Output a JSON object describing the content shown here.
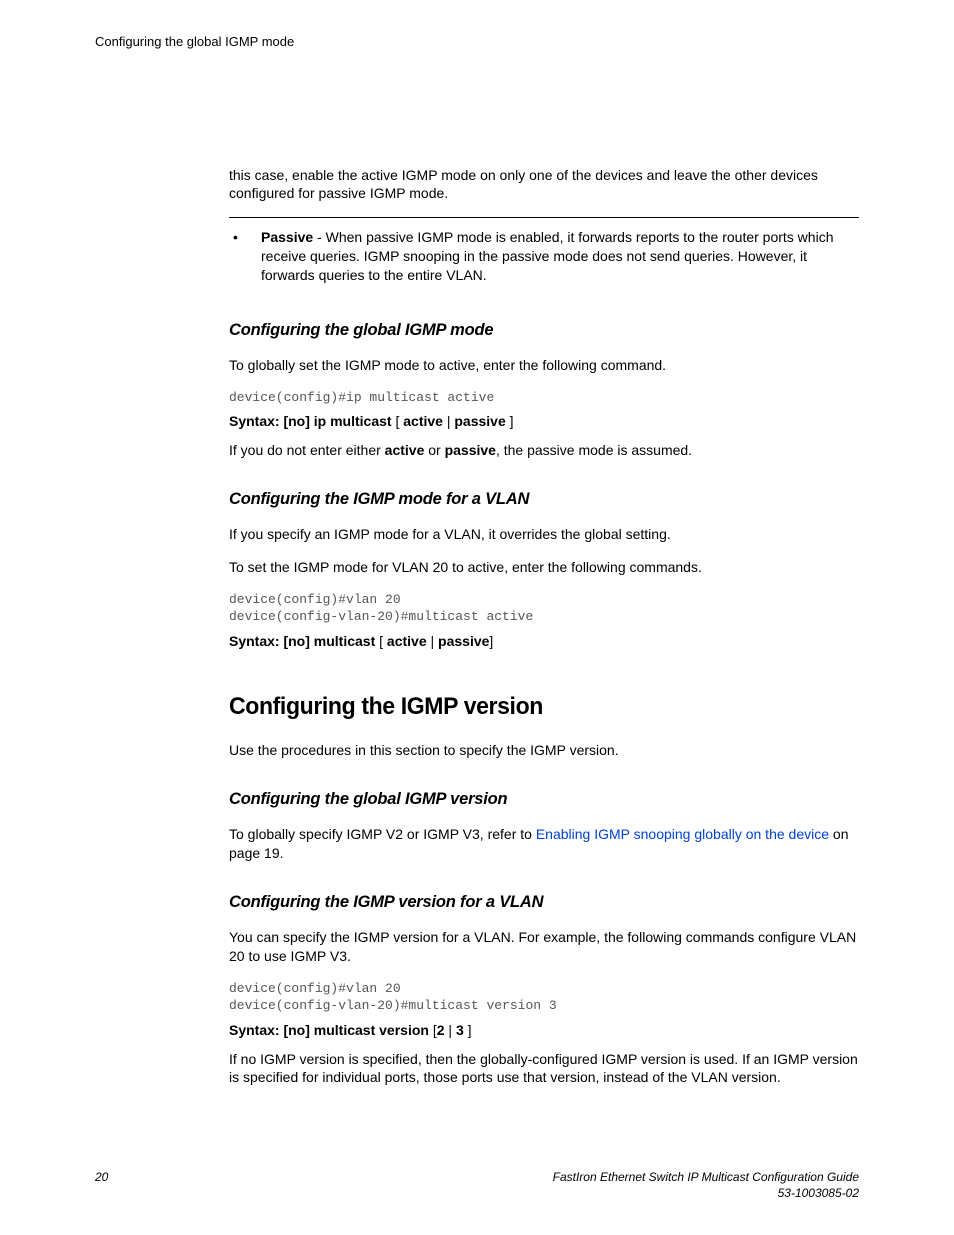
{
  "running_head": "Configuring the global IGMP mode",
  "intro_para": "this case, enable the active IGMP mode on only one of the devices and leave the other devices configured for passive IGMP mode.",
  "bullet": {
    "label": "Passive",
    "text": " - When passive IGMP mode is enabled, it forwards reports to the router ports which receive queries. IGMP snooping in the passive mode does not send queries. However, it forwards queries to the entire VLAN."
  },
  "sec_global_mode": {
    "heading": "Configuring the global IGMP mode",
    "p1": "To globally set the IGMP mode to active, enter the following command.",
    "code": "device(config)#ip multicast active",
    "syntax_prefix": "Syntax: [no] ip multicast",
    "syntax_open": " [ ",
    "syntax_opt1": "active",
    "syntax_pipe": " | ",
    "syntax_opt2": "passive",
    "syntax_close": " ]",
    "p2a": "If you do not enter either ",
    "p2b": "active",
    "p2c": " or ",
    "p2d": "passive",
    "p2e": ", the passive mode is assumed."
  },
  "sec_vlan_mode": {
    "heading": "Configuring the IGMP mode for a VLAN",
    "p1": "If you specify an IGMP mode for a VLAN, it overrides the global setting.",
    "p2": "To set the IGMP mode for VLAN 20 to active, enter the following commands.",
    "code": "device(config)#vlan 20\ndevice(config-vlan-20)#multicast active",
    "syntax_prefix": "Syntax: [no] multicast",
    "syntax_open": " [ ",
    "syntax_opt1": "active",
    "syntax_pipe": " | ",
    "syntax_opt2": "passive",
    "syntax_close": "]"
  },
  "sec_version": {
    "heading": "Configuring the IGMP version",
    "p1": "Use the procedures in this section to specify the IGMP version."
  },
  "sec_global_version": {
    "heading": "Configuring the global IGMP version",
    "p1a": "To globally specify IGMP V2 or IGMP V3, refer to ",
    "link_text": "Enabling IGMP snooping globally on the device",
    "p1b": " on page 19."
  },
  "sec_vlan_version": {
    "heading": "Configuring the IGMP version for a VLAN",
    "p1": "You can specify the IGMP version for a VLAN. For example, the following commands configure VLAN 20 to use IGMP V3.",
    "code": "device(config)#vlan 20\ndevice(config-vlan-20)#multicast version 3",
    "syntax_prefix": "Syntax: [no] multicast version",
    "syntax_open": " [",
    "syntax_opt1": "2",
    "syntax_pipe": " | ",
    "syntax_opt2": "3",
    "syntax_close": " ]",
    "p2": "If no IGMP version is specified, then the globally-configured IGMP version is used. If an IGMP version is specified for individual ports, those ports use that version, instead of the VLAN version."
  },
  "footer": {
    "page_no": "20",
    "title": "FastIron Ethernet Switch IP Multicast Configuration Guide",
    "docnum": "53-1003085-02"
  }
}
